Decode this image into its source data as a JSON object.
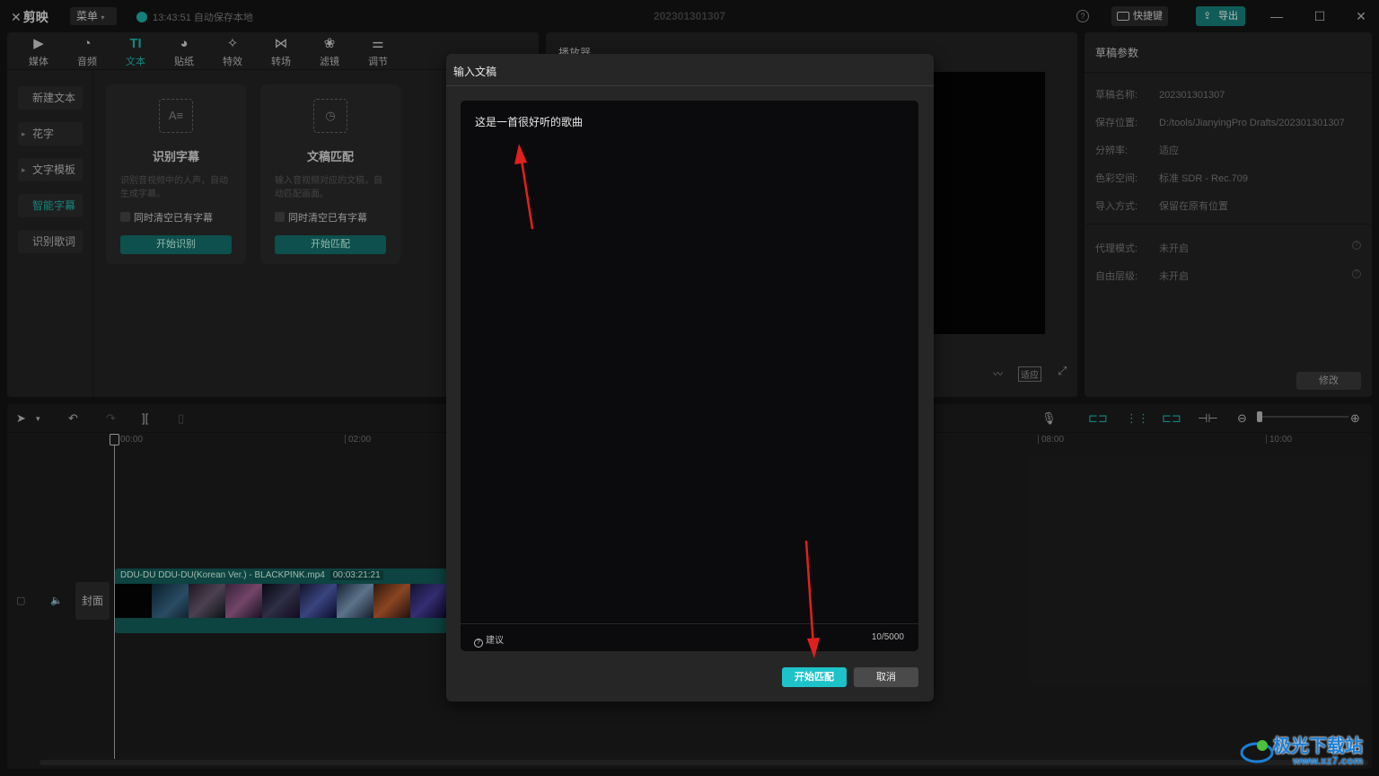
{
  "titlebar": {
    "logo": "剪映",
    "menu": "菜单",
    "save_status": "13:43:51 自动保存本地",
    "doc_title": "202301301307",
    "shortcut": "快捷键",
    "export": "导出"
  },
  "toolbar": {
    "tabs": [
      {
        "label": "媒体",
        "icon": "media-icon"
      },
      {
        "label": "音频",
        "icon": "audio-icon"
      },
      {
        "label": "文本",
        "icon": "text-icon"
      },
      {
        "label": "贴纸",
        "icon": "sticker-icon"
      },
      {
        "label": "特效",
        "icon": "effects-icon"
      },
      {
        "label": "转场",
        "icon": "transition-icon"
      },
      {
        "label": "滤镜",
        "icon": "filter-icon"
      },
      {
        "label": "调节",
        "icon": "adjust-icon"
      }
    ],
    "active": "文本"
  },
  "sidebar": {
    "items": [
      "新建文本",
      "花字",
      "文字模板",
      "智能字幕",
      "识别歌词"
    ],
    "active": "智能字幕"
  },
  "cards": [
    {
      "title": "识别字幕",
      "desc": "识别音视频中的人声，自动生成字幕。",
      "check": "同时清空已有字幕",
      "button": "开始识别"
    },
    {
      "title": "文稿匹配",
      "desc": "输入音视频对应的文稿，自动匹配画面。",
      "check": "同时清空已有字幕",
      "button": "开始匹配"
    }
  ],
  "player": {
    "title": "播放器",
    "fit": "适应"
  },
  "draft": {
    "title": "草稿参数",
    "rows": [
      {
        "k": "草稿名称:",
        "v": "202301301307"
      },
      {
        "k": "保存位置:",
        "v": "D:/tools/JianyingPro Drafts/202301301307"
      },
      {
        "k": "分辨率:",
        "v": "适应"
      },
      {
        "k": "色彩空间:",
        "v": "标准 SDR - Rec.709"
      },
      {
        "k": "导入方式:",
        "v": "保留在原有位置"
      }
    ],
    "rows2": [
      {
        "k": "代理模式:",
        "v": "未开启"
      },
      {
        "k": "自由层级:",
        "v": "未开启"
      }
    ],
    "modify": "修改"
  },
  "timeline": {
    "ruler": [
      "00:00",
      "02:00",
      "08:00",
      "10:00"
    ],
    "cover": "封面",
    "clip_name": "DDU-DU DDU-DU(Korean Ver.) - BLACKPINK.mp4",
    "clip_duration": "00:03:21:21"
  },
  "dialog": {
    "title": "输入文稿",
    "text": "这是一首很好听的歌曲",
    "hint": "建议",
    "counter": "10/5000",
    "confirm": "开始匹配",
    "cancel": "取消"
  },
  "watermark": {
    "text": "极光下载站",
    "url": "www.xz7.com"
  },
  "colors": {
    "accent": "#1ec3c9",
    "annotation_arrow": "#e02020"
  }
}
